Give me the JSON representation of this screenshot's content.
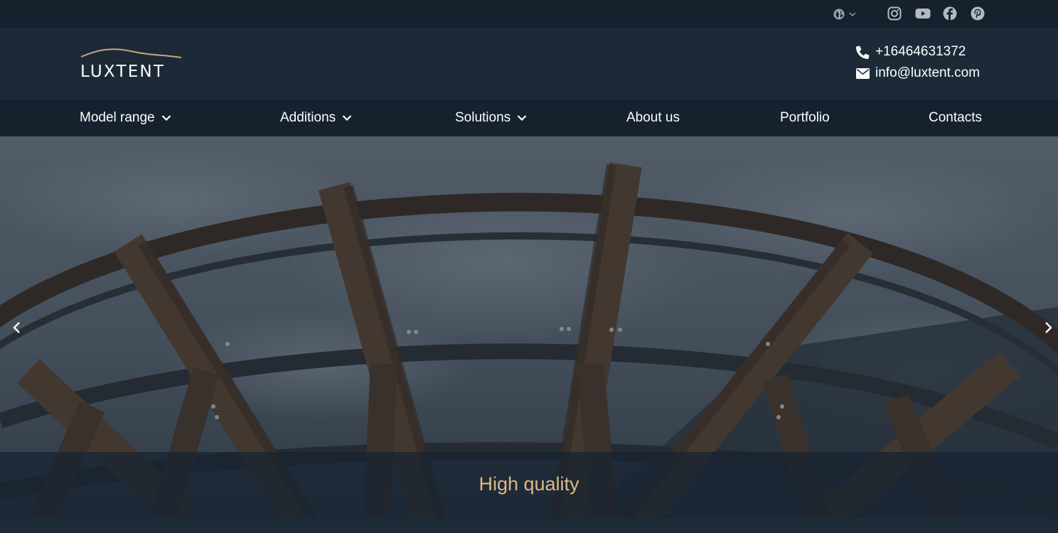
{
  "topbar": {
    "language_icon": "globe-icon",
    "language_caret_icon": "chevron-down-icon",
    "socials": [
      {
        "name": "instagram",
        "icon": "instagram-icon"
      },
      {
        "name": "youtube",
        "icon": "youtube-icon"
      },
      {
        "name": "facebook",
        "icon": "facebook-icon"
      },
      {
        "name": "pinterest",
        "icon": "pinterest-icon"
      }
    ]
  },
  "header": {
    "logo_text": "LUXTENT",
    "phone": "+16464631372",
    "email": "info@luxtent.com"
  },
  "nav": {
    "items": [
      {
        "label": "Model range",
        "dropdown": true
      },
      {
        "label": "Additions",
        "dropdown": true
      },
      {
        "label": "Solutions",
        "dropdown": true
      },
      {
        "label": "About us",
        "dropdown": false
      },
      {
        "label": "Portfolio",
        "dropdown": false
      },
      {
        "label": "Contacts",
        "dropdown": false
      }
    ]
  },
  "hero": {
    "caption": "High quality",
    "prev_icon": "chevron-left-icon",
    "next_icon": "chevron-right-icon"
  },
  "colors": {
    "topbar_bg": "#15212d",
    "header_bg": "#1c2a38",
    "nav_bg": "#15212d",
    "caption_text": "#d9b98a",
    "logo_arc": "#c8a87a"
  }
}
